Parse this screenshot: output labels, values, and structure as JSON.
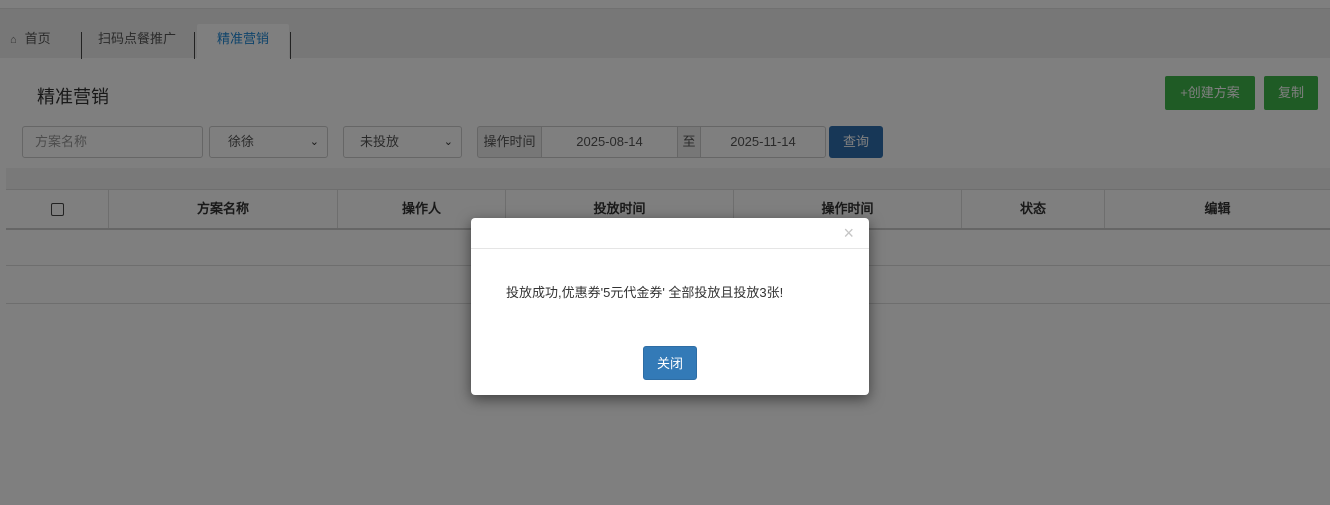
{
  "tabs": {
    "home": "首页",
    "scan": "扫码点餐推广",
    "active": "精准营销"
  },
  "page": {
    "title": "精准营销",
    "create_label": "+创建方案",
    "copy_label": "复制"
  },
  "filters": {
    "name_placeholder": "方案名称",
    "user_value": "徐徐",
    "status_value": "未投放",
    "optime_label": "操作时间",
    "date_start": "2025-08-14",
    "to_label": "至",
    "date_end": "2025-11-14",
    "query_label": "查询"
  },
  "table": {
    "columns": [
      "方案名称",
      "操作人",
      "投放时间",
      "操作时间",
      "状态",
      "编辑"
    ]
  },
  "modal": {
    "close_x": "×",
    "message": "投放成功,优惠券'5元代金券' 全部投放且投放3张!",
    "close_button": "关闭"
  },
  "colors": {
    "accent_green": "#3fb64a",
    "primary_blue": "#337ab7",
    "active_tab_text": "#1e88d6"
  }
}
